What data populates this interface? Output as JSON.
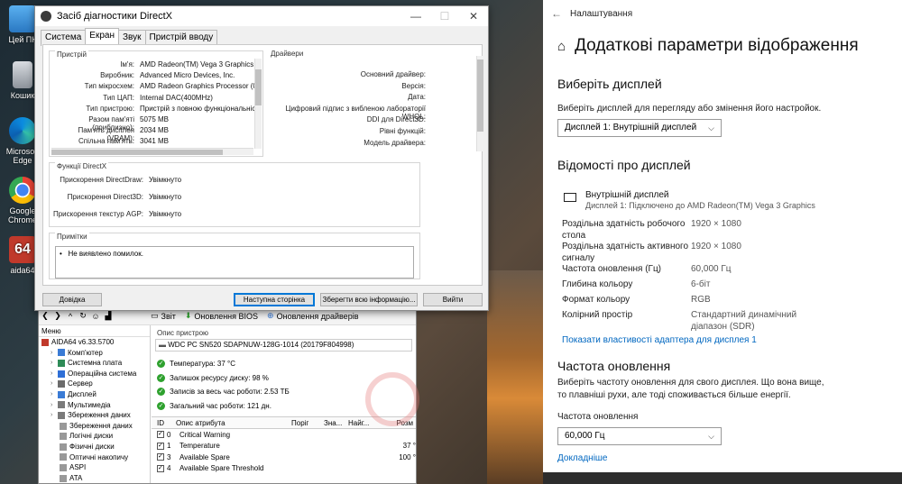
{
  "desktop": {
    "icons": [
      {
        "label": "Цей ПК"
      },
      {
        "label": "Кошик"
      },
      {
        "label": "Microsoft Edge"
      },
      {
        "label": "Google Chrome"
      },
      {
        "label": "aida64"
      }
    ]
  },
  "dxdiag": {
    "title": "Засіб діагностики DirectX",
    "tabs": [
      "Система",
      "Екран",
      "Звук",
      "Пристрій вводу"
    ],
    "active_tab": "Екран",
    "device_group_title": "Пристрій",
    "device": [
      {
        "k": "Ім'я:",
        "v": "AMD Radeon(TM) Vega 3 Graphics"
      },
      {
        "k": "Виробник:",
        "v": "Advanced Micro Devices, Inc."
      },
      {
        "k": "Тип мікросхем:",
        "v": "AMD Radeon Graphics Processor (0x15D8)"
      },
      {
        "k": "Тип ЦАП:",
        "v": "Internal DAC(400MHz)"
      },
      {
        "k": "Тип пристрою:",
        "v": "Пристрій з повною функціональністю ди"
      },
      {
        "k": "Разом пам'яті (приблизно):",
        "v": "5075 MB"
      },
      {
        "k": "Пам'ять дисплея (VRAM):",
        "v": "2034 MB"
      },
      {
        "k": "Спільна пам'ять:",
        "v": "3041 MB"
      }
    ],
    "drivers_group_title": "Драйвери",
    "drivers": [
      {
        "k": "Основний драйвер:",
        "v": ""
      },
      {
        "k": "Версія:",
        "v": ""
      },
      {
        "k": "Дата:",
        "v": ""
      },
      {
        "k": "Цифровий підпис з вибленою лабораторії WHQL:",
        "v": ""
      },
      {
        "k": "DDI для Direct3D:",
        "v": ""
      },
      {
        "k": "Рівні функцій:",
        "v": ""
      },
      {
        "k": "Модель драйвера:",
        "v": ""
      }
    ],
    "features_group_title": "Функції DirectX",
    "features": [
      {
        "k": "Прискорення DirectDraw:",
        "v": "Увімкнуто"
      },
      {
        "k": "Прискорення Direct3D:",
        "v": "Увімкнуто"
      },
      {
        "k": "Прискорення текстур AGP:",
        "v": "Увімкнуто"
      }
    ],
    "notes_group_title": "Примітки",
    "notes": [
      "Не виявлено помилок."
    ],
    "buttons": {
      "help": "Довідка",
      "next": "Наступна сторінка",
      "save": "Зберегти всю інформацію...",
      "exit": "Вийти"
    }
  },
  "aida": {
    "toolbar": {
      "report": "Звіт",
      "bios": "Оновлення BIOS",
      "drivers": "Оновлення драйверів"
    },
    "menu": "Меню",
    "tree": [
      {
        "label": "AIDA64 v6.33.5700",
        "indent": 0,
        "color": "#c0392b"
      },
      {
        "label": "Комп'ютер",
        "indent": 1,
        "color": "#3a7bd5"
      },
      {
        "label": "Системна плата",
        "indent": 1,
        "color": "#2e8b57"
      },
      {
        "label": "Операційна система",
        "indent": 1,
        "color": "#2f6fd6"
      },
      {
        "label": "Сервер",
        "indent": 1,
        "color": "#6b6b6b"
      },
      {
        "label": "Дисплей",
        "indent": 1,
        "color": "#3a7bd5"
      },
      {
        "label": "Мультимедіа",
        "indent": 1,
        "color": "#7a7a7a"
      },
      {
        "label": "Збереження даних",
        "indent": 1,
        "color": "#7a7a7a"
      },
      {
        "label": "Збереження даних",
        "indent": 2,
        "color": "#999999"
      },
      {
        "label": "Логічні диски",
        "indent": 2,
        "color": "#999999"
      },
      {
        "label": "Фізичні диски",
        "indent": 2,
        "color": "#999999"
      },
      {
        "label": "Оптичні накопичу",
        "indent": 2,
        "color": "#999999"
      },
      {
        "label": "ASPI",
        "indent": 2,
        "color": "#999999"
      },
      {
        "label": "ATA",
        "indent": 2,
        "color": "#999999"
      }
    ],
    "device_desc_label": "Опис пристрою",
    "device_desc": "WDC PC SN520 SDAPNUW-128G-1014 (20179F804998)",
    "status": [
      {
        "label": "Температура: 37 °C"
      },
      {
        "label": "Залишок ресурсу диску: 98 %"
      },
      {
        "label": "Записів за весь час роботи: 2.53 ТБ"
      },
      {
        "label": "Загальний час роботи: 121 дн."
      }
    ],
    "attr_headers": [
      "ID",
      "Опис атрибута",
      "Поріг",
      "Зна...",
      "Найг...",
      "Розм"
    ],
    "attrs": [
      {
        "id": "0",
        "name": "Critical Warning",
        "val": ""
      },
      {
        "id": "1",
        "name": "Temperature",
        "val": "37 °"
      },
      {
        "id": "3",
        "name": "Available Spare",
        "val": "100 °"
      },
      {
        "id": "4",
        "name": "Available Spare Threshold",
        "val": ""
      }
    ]
  },
  "settings": {
    "window_title": "Налаштування",
    "page_title": "Додаткові параметри відображення",
    "choose_display_heading": "Виберіть дисплей",
    "choose_display_desc": "Виберіть дисплей для перегляду або змінення його настройок.",
    "display_select": "Дисплей 1: Внутрішній дисплей",
    "info_heading": "Відомості про дисплей",
    "monitor_name": "Внутрішній дисплей",
    "monitor_sub": "Дисплей 1: Підключено до AMD Radeon(TM) Vega 3 Graphics",
    "rows": [
      {
        "k": "Роздільна здатність робочого стола",
        "v": "1920 × 1080"
      },
      {
        "k": "Роздільна здатність активного сигналу",
        "v": "1920 × 1080"
      },
      {
        "k": "Частота оновлення (Гц)",
        "v": "60,000 Гц"
      },
      {
        "k": "Глибина кольору",
        "v": "6-біт"
      },
      {
        "k": "Формат кольору",
        "v": "RGB"
      },
      {
        "k": "Колірний простір",
        "v": "Стандартний динамічний діапазон (SDR)"
      }
    ],
    "adapter_link": "Показати властивості адаптера для дисплея 1",
    "refresh_heading": "Частота оновлення",
    "refresh_desc": "Виберіть частоту оновлення для свого дисплея. Що вона вище, то плавніші рухи, але тоді споживається більше енергії.",
    "refresh_label": "Частота оновлення",
    "refresh_select": "60,000 Гц",
    "more_link": "Докладніше"
  }
}
